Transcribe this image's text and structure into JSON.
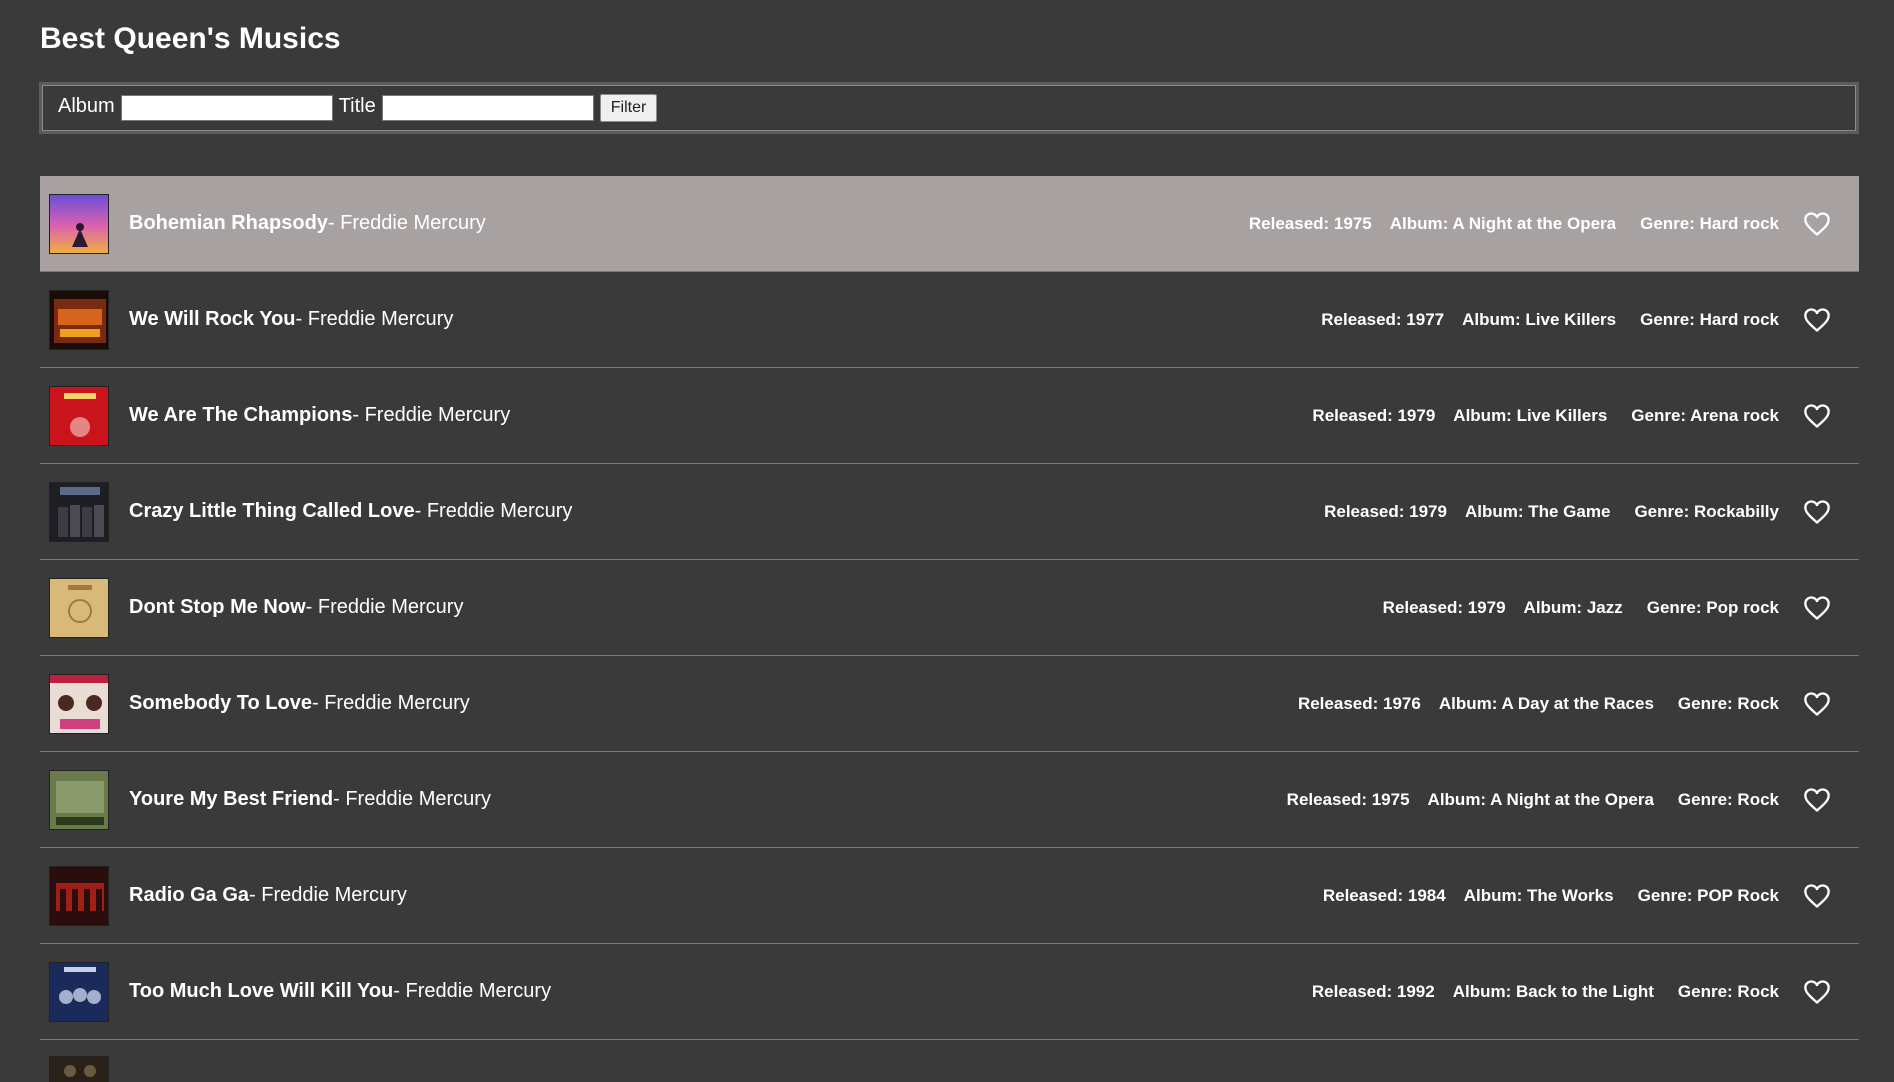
{
  "page": {
    "title": "Best Queen's Musics"
  },
  "filter": {
    "album_label": "Album",
    "album_value": "",
    "title_label": "Title",
    "title_value": "",
    "button_label": "Filter"
  },
  "colors": {
    "background": "#3a3a3a",
    "selected_row": "#a7a1a1",
    "text": "#ffffff"
  },
  "songs": [
    {
      "title": "Bohemian Rhapsody",
      "artist": "- Freddie Mercury",
      "released": "Released: 1975",
      "album": "Album: A Night at the Opera",
      "genre": "Genre: Hard rock",
      "selected": true
    },
    {
      "title": "We Will Rock You",
      "artist": "- Freddie Mercury",
      "released": "Released: 1977",
      "album": "Album: Live Killers",
      "genre": "Genre: Hard rock"
    },
    {
      "title": "We Are The Champions",
      "artist": "- Freddie Mercury",
      "released": "Released: 1979",
      "album": "Album: Live Killers",
      "genre": "Genre: Arena rock"
    },
    {
      "title": "Crazy Little Thing Called Love",
      "artist": "- Freddie Mercury",
      "released": "Released: 1979",
      "album": "Album: The Game",
      "genre": "Genre: Rockabilly"
    },
    {
      "title": "Dont Stop Me Now",
      "artist": "- Freddie Mercury",
      "released": "Released: 1979",
      "album": "Album: Jazz",
      "genre": "Genre: Pop rock"
    },
    {
      "title": "Somebody To Love",
      "artist": "- Freddie Mercury",
      "released": "Released: 1976",
      "album": "Album: A Day at the Races",
      "genre": "Genre: Rock"
    },
    {
      "title": "Youre My Best Friend",
      "artist": "- Freddie Mercury",
      "released": "Released: 1975",
      "album": "Album: A Night at the Opera",
      "genre": "Genre: Rock"
    },
    {
      "title": "Radio Ga Ga",
      "artist": "- Freddie Mercury",
      "released": "Released: 1984",
      "album": "Album: The Works",
      "genre": "Genre: POP Rock"
    },
    {
      "title": "Too Much Love Will Kill You",
      "artist": "- Freddie Mercury",
      "released": "Released: 1992",
      "album": "Album: Back to the Light",
      "genre": "Genre: Rock"
    }
  ],
  "icons": {
    "favorite": "heart-outline-icon"
  }
}
